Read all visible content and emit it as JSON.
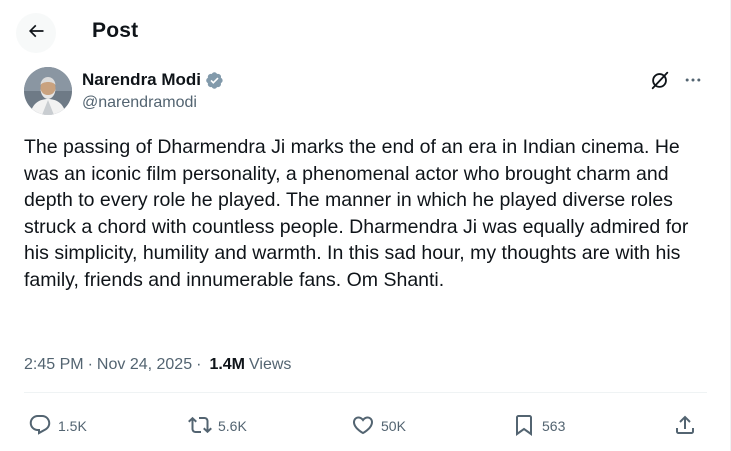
{
  "header": {
    "title": "Post",
    "back_icon": "arrow-left-icon"
  },
  "author": {
    "name": "Narendra Modi",
    "handle": "@narendramodi",
    "verified": true,
    "verified_color": "#829aab"
  },
  "toolbar": {
    "grok_icon": "grok-icon",
    "more_icon": "more-horizontal-icon"
  },
  "post": {
    "text": "The passing of Dharmendra Ji marks the end of an era in Indian cinema. He was an iconic film personality, a phenomenal actor who brought charm and depth to every role he played. The manner in which he played diverse roles struck a chord with countless people. Dharmendra Ji was equally admired for his simplicity, humility and warmth. In this sad hour, my thoughts are with his family, friends and innumerable fans. Om Shanti."
  },
  "meta": {
    "time": "2:45 PM",
    "separator": "·",
    "date": "Nov 24, 2025",
    "views_count": "1.4M",
    "views_label": "Views"
  },
  "actions": {
    "reply": {
      "icon": "reply-icon",
      "count": "1.5K"
    },
    "repost": {
      "icon": "repost-icon",
      "count": "5.6K"
    },
    "like": {
      "icon": "heart-icon",
      "count": "50K"
    },
    "bookmark": {
      "icon": "bookmark-icon",
      "count": "563"
    },
    "share": {
      "icon": "share-icon"
    }
  },
  "colors": {
    "text": "#0f1419",
    "secondary": "#536471",
    "border": "#eff3f4"
  }
}
